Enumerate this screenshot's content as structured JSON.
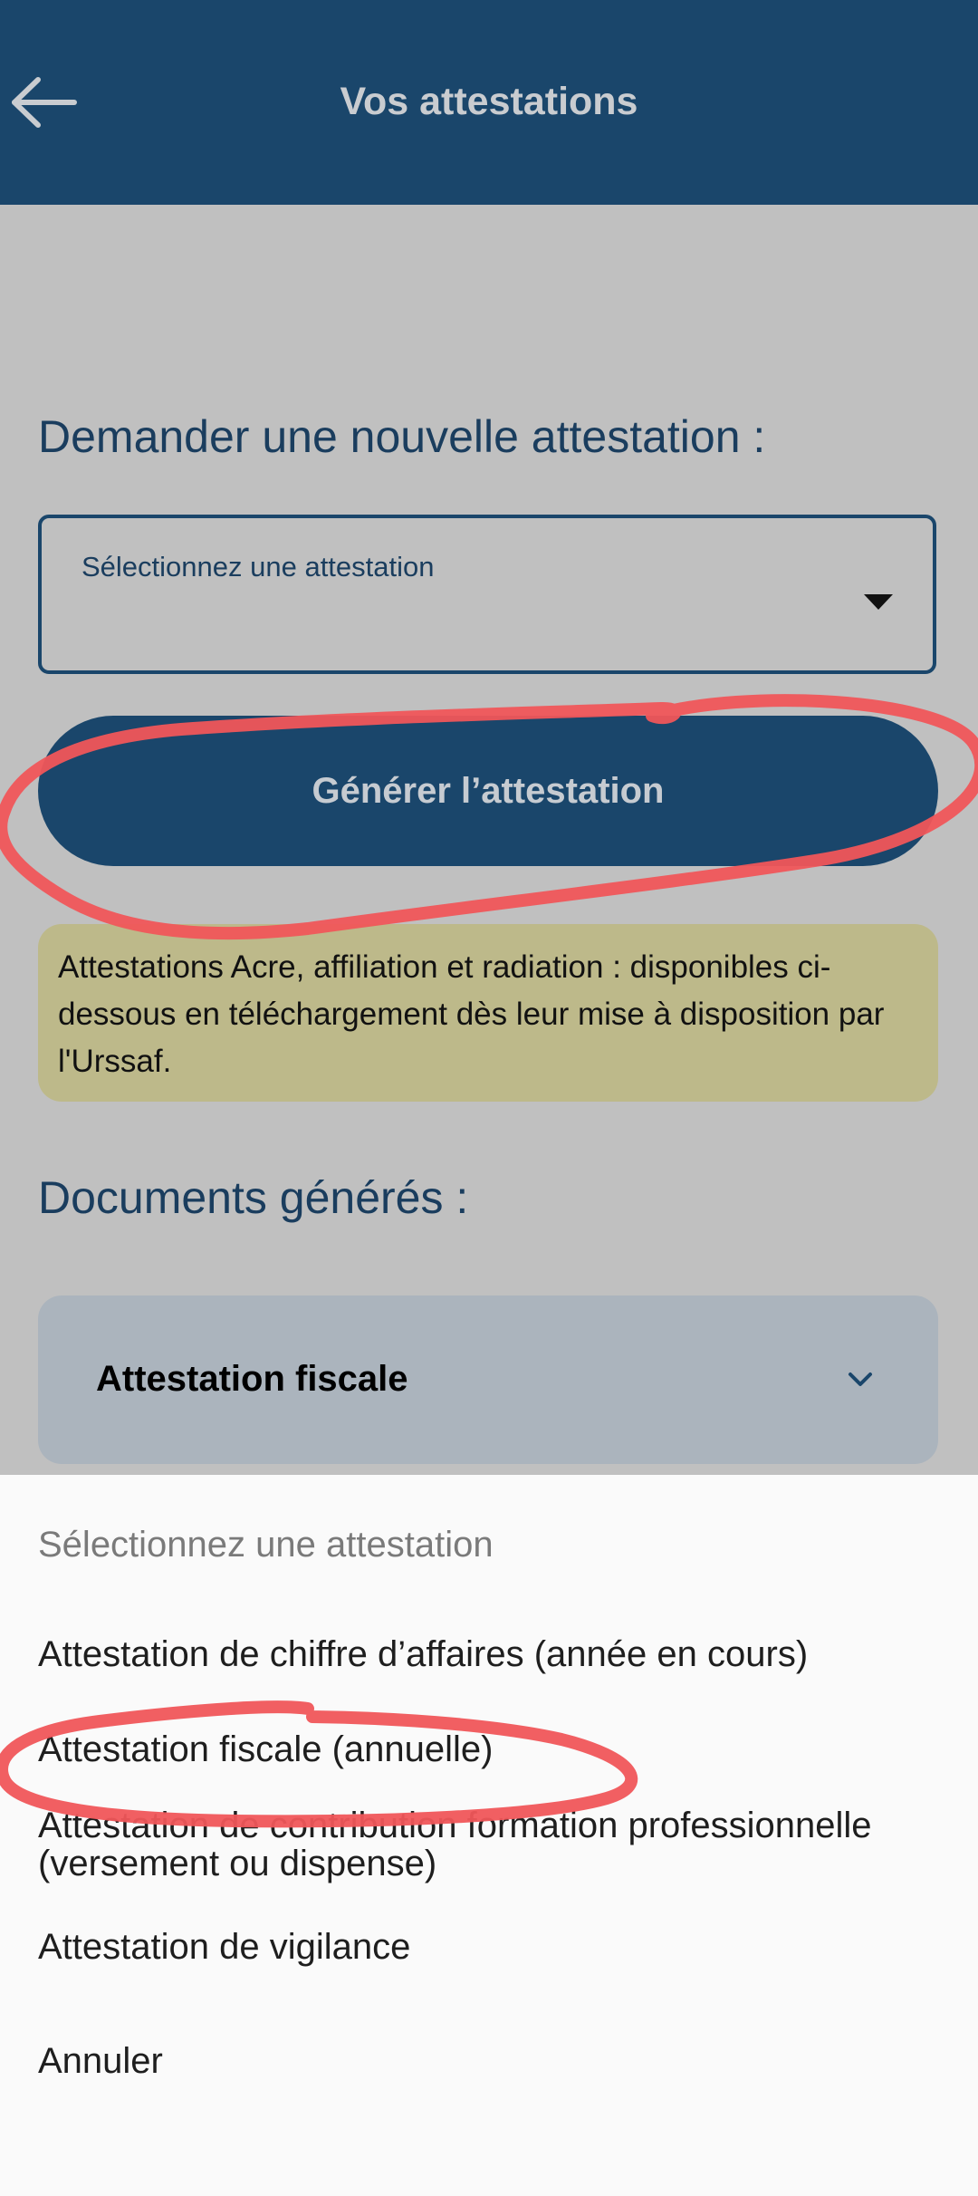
{
  "appbar": {
    "title": "Vos attestations",
    "back_icon": "arrow-left-icon"
  },
  "request_section": {
    "title": "Demander une nouvelle attestation :",
    "select_label": "Sélectionnez une attestation",
    "select_value": "",
    "generate_button": "Générer l’attestation"
  },
  "notice": {
    "text": "Attestations Acre, affiliation et radiation : disponibles ci-dessous en téléchargement dès leur mise à disposition par l'Urssaf.",
    "background": "#bdb98a"
  },
  "documents_section": {
    "title": "Documents générés :",
    "accordion_title": "Attestation fiscale",
    "accordion_icon": "chevron-down-icon"
  },
  "sheet": {
    "header": "Sélectionnez une attestation",
    "options": [
      "Attestation de chiffre d’affaires (année en cours)",
      "Attestation fiscale (annuelle)",
      "Attestation de contribution formation professionnelle (versement ou dispense)",
      "Attestation de vigilance"
    ],
    "cancel": "Annuler"
  },
  "colors": {
    "primary": "#1a466b",
    "annotation": "#f0565a",
    "scrim": "#c0c0c0"
  }
}
